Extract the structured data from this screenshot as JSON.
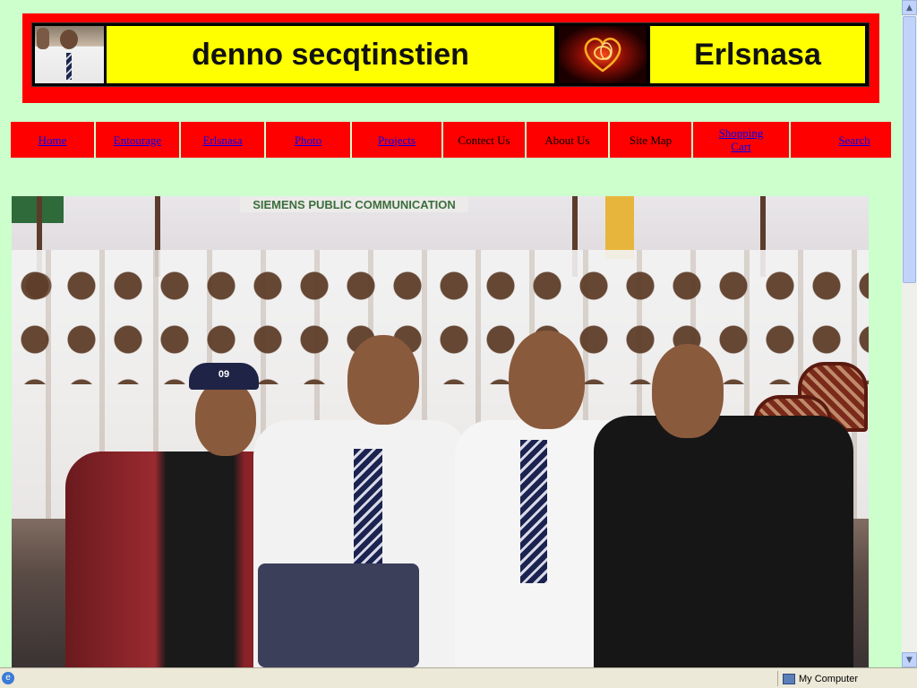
{
  "banner": {
    "title_left": "denno secqtinstien",
    "title_right": "Erlsnasa"
  },
  "nav": {
    "items": [
      {
        "label": "Home",
        "link": true
      },
      {
        "label": "Entourage",
        "link": true
      },
      {
        "label": "Erlsnasa",
        "link": true
      },
      {
        "label": "Photo",
        "link": true
      },
      {
        "label": "Projects",
        "link": true
      },
      {
        "label": "Contect Us",
        "link": false
      },
      {
        "label": "About Us",
        "link": false
      },
      {
        "label": "Site Map",
        "link": false
      },
      {
        "label": "Shopping Cart",
        "link": true
      },
      {
        "label": "Search",
        "link": true
      }
    ]
  },
  "photo": {
    "banner_text": "SIEMENS PUBLIC COMMUNICATION",
    "cap_text": "09"
  },
  "statusbar": {
    "zone": "My Computer"
  },
  "colors": {
    "page_background": "#ccffcc",
    "banner_red": "#ff0000",
    "title_yellow": "#ffff00",
    "nav_red": "#ff0000",
    "link_blue": "#0000ee"
  }
}
